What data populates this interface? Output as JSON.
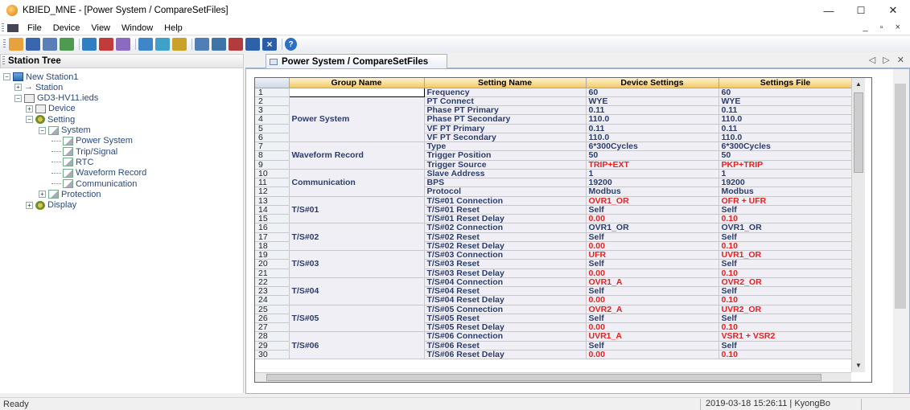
{
  "window": {
    "title": "KBIED_MNE - [Power System / CompareSetFiles]",
    "minimize": "—",
    "maximize": "☐",
    "close": "✕"
  },
  "menu": [
    "File",
    "Device",
    "View",
    "Window",
    "Help"
  ],
  "mdi_controls": "_ ▫ ×",
  "left_panel": {
    "title": "Station Tree"
  },
  "tree": [
    {
      "label": "New Station1",
      "depth": 0,
      "icon": "station-icon"
    },
    {
      "label": "Station",
      "depth": 1,
      "icon": "arrow-icon"
    },
    {
      "label": "GD3-HV11.ieds",
      "depth": 1,
      "icon": "device-icon"
    },
    {
      "label": "Device",
      "depth": 2,
      "icon": "device-icon"
    },
    {
      "label": "Setting",
      "depth": 2,
      "icon": "gear-icon"
    },
    {
      "label": "System",
      "depth": 3,
      "icon": "document-icon"
    },
    {
      "label": "Power System",
      "depth": 4,
      "icon": "document-icon"
    },
    {
      "label": "Trip/Signal",
      "depth": 4,
      "icon": "document-icon"
    },
    {
      "label": "RTC",
      "depth": 4,
      "icon": "document-icon"
    },
    {
      "label": "Waveform Record",
      "depth": 4,
      "icon": "document-icon"
    },
    {
      "label": "Communication",
      "depth": 4,
      "icon": "document-icon"
    },
    {
      "label": "Protection",
      "depth": 3,
      "icon": "document-icon"
    },
    {
      "label": "Display",
      "depth": 2,
      "icon": "gear-icon"
    }
  ],
  "tab": {
    "label": "Power System / CompareSetFiles",
    "nav": "◁ ▷ ✕"
  },
  "grid": {
    "columns": [
      "Group Name",
      "Setting Name",
      "Device Settings",
      "Settings File"
    ],
    "groups": [
      {
        "name": "",
        "start": 1,
        "span": 1
      },
      {
        "name": "Power System",
        "start": 2,
        "span": 5
      },
      {
        "name": "Waveform Record",
        "start": 7,
        "span": 3
      },
      {
        "name": "Communication",
        "start": 10,
        "span": 3
      },
      {
        "name": "T/S#01",
        "start": 13,
        "span": 3
      },
      {
        "name": "T/S#02",
        "start": 16,
        "span": 3
      },
      {
        "name": "T/S#03",
        "start": 19,
        "span": 3
      },
      {
        "name": "T/S#04",
        "start": 22,
        "span": 3
      },
      {
        "name": "T/S#05",
        "start": 25,
        "span": 3
      },
      {
        "name": "T/S#06",
        "start": 28,
        "span": 3
      }
    ],
    "rows": [
      {
        "n": "1",
        "name": "Frequency",
        "dev": "60",
        "file": "60",
        "diff": false
      },
      {
        "n": "2",
        "name": "PT Connect",
        "dev": "WYE",
        "file": "WYE",
        "diff": false
      },
      {
        "n": "3",
        "name": "Phase PT Primary",
        "dev": "0.11",
        "file": "0.11",
        "diff": false
      },
      {
        "n": "4",
        "name": "Phase PT Secondary",
        "dev": "110.0",
        "file": "110.0",
        "diff": false
      },
      {
        "n": "5",
        "name": "VF PT Primary",
        "dev": "0.11",
        "file": "0.11",
        "diff": false
      },
      {
        "n": "6",
        "name": "VF PT Secondary",
        "dev": "110.0",
        "file": "110.0",
        "diff": false
      },
      {
        "n": "7",
        "name": "Type",
        "dev": "6*300Cycles",
        "file": "6*300Cycles",
        "diff": false
      },
      {
        "n": "8",
        "name": "Trigger Position",
        "dev": "50",
        "file": "50",
        "diff": false
      },
      {
        "n": "9",
        "name": "Trigger Source",
        "dev": "TRIP+EXT",
        "file": "PKP+TRIP",
        "diff": true
      },
      {
        "n": "10",
        "name": "Slave Address",
        "dev": "1",
        "file": "1",
        "diff": false
      },
      {
        "n": "11",
        "name": "BPS",
        "dev": "19200",
        "file": "19200",
        "diff": false
      },
      {
        "n": "12",
        "name": "Protocol",
        "dev": "Modbus",
        "file": "Modbus",
        "diff": false
      },
      {
        "n": "13",
        "name": "T/S#01 Connection",
        "dev": "OVR1_OR",
        "file": "OFR + UFR",
        "diff": true
      },
      {
        "n": "14",
        "name": "T/S#01 Reset",
        "dev": "Self",
        "file": "Self",
        "diff": false
      },
      {
        "n": "15",
        "name": "T/S#01 Reset Delay",
        "dev": "0.00",
        "file": "0.10",
        "diff": true
      },
      {
        "n": "16",
        "name": "T/S#02 Connection",
        "dev": "OVR1_OR",
        "file": "OVR1_OR",
        "diff": false
      },
      {
        "n": "17",
        "name": "T/S#02 Reset",
        "dev": "Self",
        "file": "Self",
        "diff": false
      },
      {
        "n": "18",
        "name": "T/S#02 Reset Delay",
        "dev": "0.00",
        "file": "0.10",
        "diff": true
      },
      {
        "n": "19",
        "name": "T/S#03 Connection",
        "dev": "UFR",
        "file": "UVR1_OR",
        "diff": true
      },
      {
        "n": "20",
        "name": "T/S#03 Reset",
        "dev": "Self",
        "file": "Self",
        "diff": false
      },
      {
        "n": "21",
        "name": "T/S#03 Reset Delay",
        "dev": "0.00",
        "file": "0.10",
        "diff": true
      },
      {
        "n": "22",
        "name": "T/S#04 Connection",
        "dev": "OVR1_A",
        "file": "OVR2_OR",
        "diff": true
      },
      {
        "n": "23",
        "name": "T/S#04 Reset",
        "dev": "Self",
        "file": "Self",
        "diff": false
      },
      {
        "n": "24",
        "name": "T/S#04 Reset Delay",
        "dev": "0.00",
        "file": "0.10",
        "diff": true
      },
      {
        "n": "25",
        "name": "T/S#05 Connection",
        "dev": "OVR2_A",
        "file": "UVR2_OR",
        "diff": true
      },
      {
        "n": "26",
        "name": "T/S#05 Reset",
        "dev": "Self",
        "file": "Self",
        "diff": false
      },
      {
        "n": "27",
        "name": "T/S#05 Reset Delay",
        "dev": "0.00",
        "file": "0.10",
        "diff": true
      },
      {
        "n": "28",
        "name": "T/S#06 Connection",
        "dev": "UVR1_A",
        "file": "VSR1 + VSR2",
        "diff": true
      },
      {
        "n": "29",
        "name": "T/S#06 Reset",
        "dev": "Self",
        "file": "Self",
        "diff": false
      },
      {
        "n": "30",
        "name": "T/S#06 Reset Delay",
        "dev": "0.00",
        "file": "0.10",
        "diff": true
      }
    ]
  },
  "colors": {
    "diff_text": "#e52222",
    "header_gold": "#f3c96b",
    "group_bg": "#f0eff6"
  },
  "status": {
    "ready": "Ready",
    "timestamp": "2019-03-18 15:26:11",
    "user": "KyongBo"
  }
}
